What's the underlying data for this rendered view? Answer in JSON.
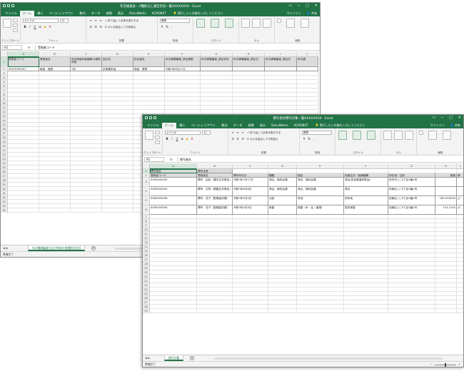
{
  "window1": {
    "title": "年次検査表・2種給与と通告状況一覧XXXXXXXX - Excel",
    "tabs": [
      "ファイル",
      "ホーム",
      "挿入",
      "ページ レイアウト",
      "数式",
      "データ",
      "校閲",
      "表示",
      "DocuWorks",
      "ACROBAT"
    ],
    "tell_me": "実行したい作業を入力してください",
    "signin": "サインイン",
    "share": "共有",
    "font_name": "メイリオ",
    "number_format": "標準",
    "wrap_text": "折り返して全体を表示する",
    "merge_center": "セルを結合して中央揃え",
    "group_labels": [
      "クリップボード",
      "フォント",
      "配置",
      "数値",
      "スタイル",
      "セル",
      "編集"
    ],
    "name_box": "A1",
    "formula_value": "受検者コード",
    "columns": [
      "A",
      "B",
      "C",
      "D",
      "E",
      "F",
      "G",
      "H",
      "I",
      "J"
    ],
    "rows": [
      "1",
      "2",
      "3",
      "4",
      "5",
      "6",
      "7",
      "8",
      "9",
      "10",
      "11",
      "12",
      "13",
      "14",
      "15",
      "16",
      "17",
      "18",
      "19",
      "20",
      "21",
      "22",
      "23",
      "24",
      "25",
      "26",
      "27",
      "28",
      "29",
      "30",
      "31",
      "32",
      "33",
      "34",
      "35"
    ],
    "header_row": [
      "受検者コード",
      "受検者名",
      "年次検査年齢階層の通知年数",
      "会社名",
      "担当者名",
      "年次健康審査_提出期限",
      "年次健康審査_提出状況",
      "年次健康審査_提出日",
      "年次健康審査_提出先",
      "年次健"
    ],
    "data_row": [
      "ZOUY000001",
      "新組　福男",
      "1年",
      "未準備未組",
      "新組　健男",
      "令和3年6月17日",
      "",
      "",
      "",
      ""
    ],
    "sheet_tab": "年次健康審査日及び結果の書類提出状況",
    "status": "準備完了"
  },
  "window2": {
    "title": "標号者別標号対象一覧XXXXXXXX - Excel",
    "tabs": [
      "ファイル",
      "ホーム",
      "挿入",
      "ページ レイアウト",
      "数式",
      "データ",
      "校閲",
      "表示",
      "DocuWorks",
      "ACROBAT"
    ],
    "tell_me": "実行したい作業を入力してください",
    "signin": "サインイン",
    "share": "共有",
    "font_name": "メイリオ",
    "number_format": "標準",
    "wrap_text": "折り返して全体を表示する",
    "merge_center": "セルを結合して中央揃え",
    "group_labels": [
      "クリップボード",
      "フォント",
      "配置",
      "数値",
      "スタイル",
      "セル",
      "編集"
    ],
    "name_box": "A1",
    "formula_value": "標号者名",
    "columns": [
      "A",
      "B",
      "C",
      "D",
      "E",
      "F",
      "G",
      "H",
      "I"
    ],
    "rows": [
      "1",
      "2",
      "3",
      "4",
      "5",
      "6",
      "7",
      "8",
      "9",
      "10",
      "11",
      "12",
      "13",
      "14",
      "15",
      "16",
      "17",
      "18",
      "19",
      "20",
      "21",
      "22",
      "23",
      "24",
      "25",
      "26",
      "27",
      "28",
      "29"
    ],
    "row1": [
      "標号者名",
      "標号太郎"
    ],
    "header_row": [
      "受検者コード",
      "受検者名",
      "標号年月日",
      "種類",
      "細目",
      "利用区分・医療機関",
      "所在地・住所",
      "数値",
      "単位"
    ],
    "data_rows": [
      [
        "0000000004",
        "標号　由紀（選手生年県会）",
        "令和3年7月17日",
        "済合、無料会員",
        "済合、無料会員",
        "済合(所定都道府県会)",
        "所沢市○○3丁目3番1号",
        "",
        ""
      ],
      [
        "0000000005",
        "標号　五郎（健康生年県会）",
        "令和3年6月6日",
        "済合、無料会員",
        "済合、無料会員",
        "済合",
        "田無区○○3丁目3番1号",
        "",
        ""
      ],
      [
        "0000000006",
        "標号　花子（配偶者扶養）",
        "令和3年5月5日",
        "北部",
        "宅地",
        "所有地",
        "田無区○○3丁目3番1号",
        "165.000000",
        "㎡"
      ],
      [
        "0000000006",
        "標号　花子（配偶者扶養）",
        "令和3年5月5日",
        "家屋",
        "家屋（木・瓦・屋根）",
        "居宅家屋",
        "田無区○○3丁目3番1号",
        "124.2100",
        "㎡"
      ]
    ],
    "sheet_tab": "標号対象",
    "status": "準備完了"
  }
}
